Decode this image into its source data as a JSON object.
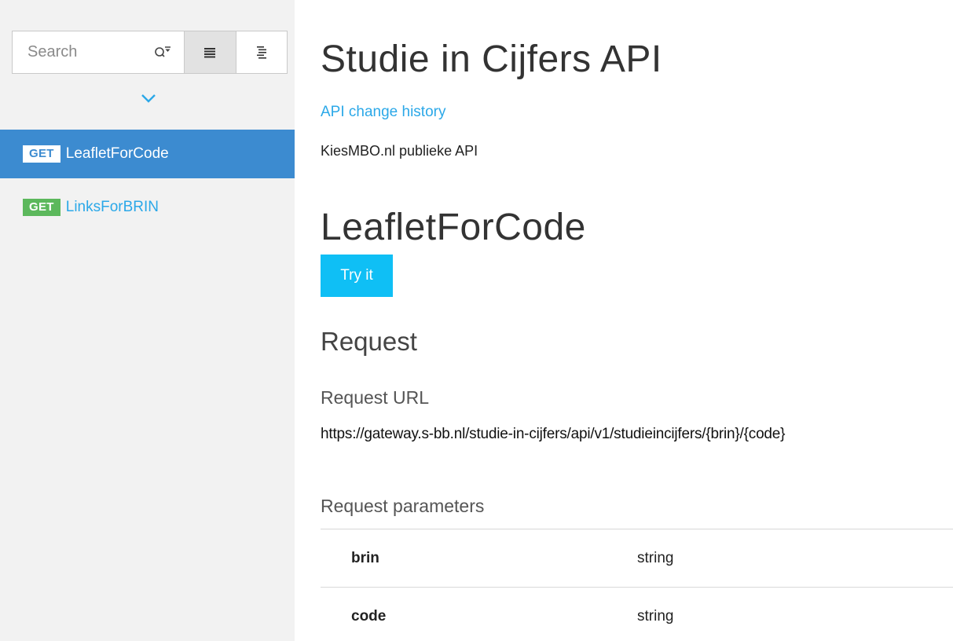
{
  "sidebar": {
    "search": {
      "placeholder": "Search",
      "value": ""
    },
    "view_buttons": [
      {
        "name": "list-view",
        "icon": "list-icon",
        "active": true
      },
      {
        "name": "grouped-view",
        "icon": "grouped-list-icon",
        "active": false
      }
    ],
    "items": [
      {
        "method": "GET",
        "label": "LeafletForCode",
        "selected": true
      },
      {
        "method": "GET",
        "label": "LinksForBRIN",
        "selected": false
      }
    ]
  },
  "main": {
    "api_title": "Studie in Cijfers API",
    "change_history_link": "API change history",
    "description": "KiesMBO.nl publieke API",
    "operation_title": "LeafletForCode",
    "try_button": "Try it",
    "request_heading": "Request",
    "request_url_label": "Request URL",
    "request_url": "https://gateway.s-bb.nl/studie-in-cijfers/api/v1/studieincijfers/{brin}/{code}",
    "request_params_label": "Request parameters",
    "params": [
      {
        "name": "brin",
        "type": "string"
      },
      {
        "name": "code",
        "type": "string"
      }
    ]
  },
  "colors": {
    "sidebar_bg": "#f2f2f2",
    "selected_bg": "#3c8bd0",
    "link": "#2ba8e8",
    "get_badge_green": "#5cb85c",
    "try_button": "#0fbff5"
  }
}
